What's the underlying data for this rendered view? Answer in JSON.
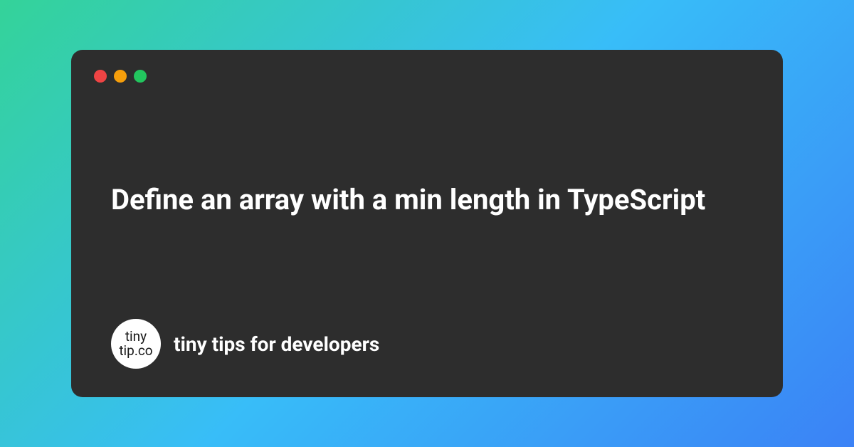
{
  "window": {
    "title": "Define an array with a min length in TypeScript",
    "traffic_lights": {
      "red": "#ef4444",
      "yellow": "#f59e0b",
      "green": "#22c55e"
    }
  },
  "footer": {
    "logo": {
      "line1": "tiny",
      "line2": "tip.co"
    },
    "tagline": "tiny tips for developers"
  },
  "colors": {
    "window_bg": "#2d2d2d",
    "gradient_start": "#34d399",
    "gradient_mid": "#38bdf8",
    "gradient_end": "#3b82f6"
  }
}
